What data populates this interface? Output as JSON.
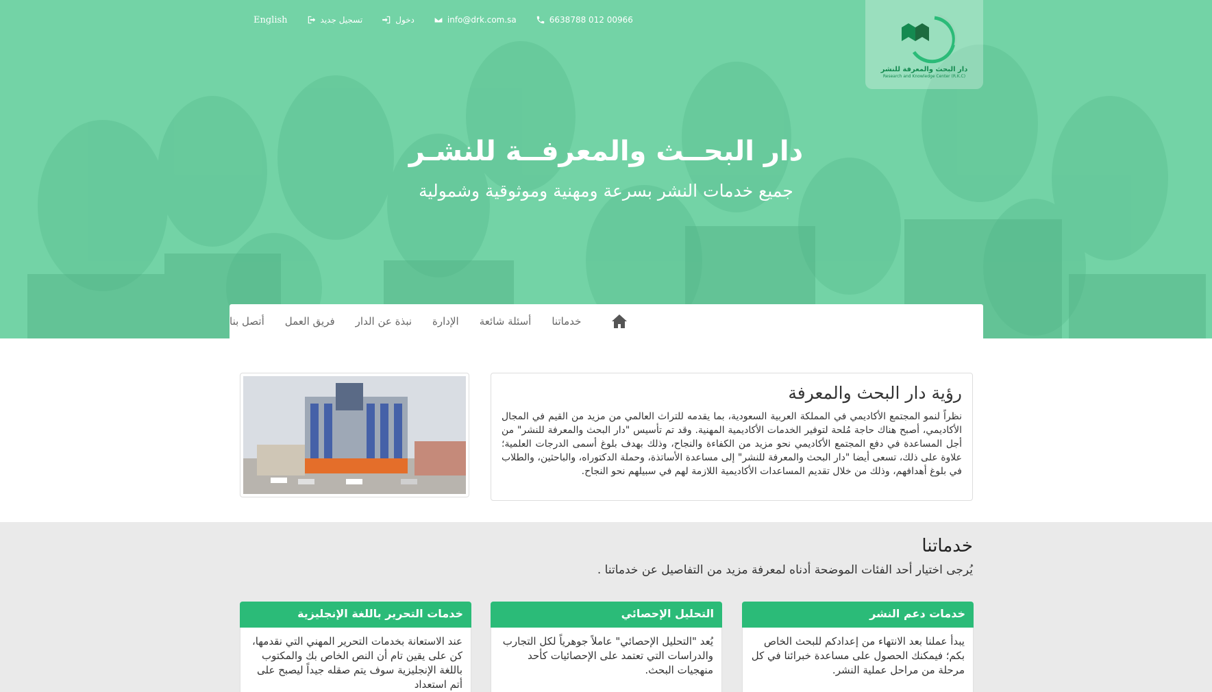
{
  "topbar": {
    "phone": "6638788 012 00966",
    "email": "info@drk.com.sa",
    "login": "دخول",
    "register": "تسجيل جديد",
    "language": "English"
  },
  "logo": {
    "name": "دار البحث والمعرفة للنشر",
    "subtitle": "Research and Knowledge Center (R.K.C)"
  },
  "hero": {
    "title": "دار البحــث والمعرفــة للنشـر",
    "subtitle": "جميع خدمات النشر بسرعة ومهنية وموثوقية وشمولية"
  },
  "nav": {
    "items": [
      "خدماتنا",
      "أسئلة شائعة",
      "الإدارة",
      "نبذة عن الدار",
      "فريق العمل",
      "أتصل بنا"
    ]
  },
  "about": {
    "title": "رؤية دار البحث والمعرفة",
    "text": "نظراً لنمو المجتمع الأكاديمي في المملكة العربية السعودية، بما يقدمه للتراث العالمي من مزيد من القيم في المجال الأكاديمي، أصبح هناك حاجة مُلحة لتوفير الخدمات الأكاديمية المهنية. وقد تم تأسيس \"دار البحث والمعرفة للنشر\" من أجل المساعدة في دفع المجتمع الأكاديمي نحو مزيد من الكفاءة والنجاح، وذلك بهدف بلوغ أسمى الدرجات العلمية؛ علاوة على ذلك، تسعى أيضا \"دار البحث والمعرفة للنشر\" إلى مساعدة الأساتذة، وحملة الدكتوراه، والباحثين، والطلاب في بلوغ أهدافهم، وذلك من خلال تقديم المساعدات الأكاديمية اللازمة لهم في سبيلهم نحو النجاح."
  },
  "services": {
    "title": "خدماتنا",
    "description": "يُرجى اختيار أحد الفئات الموضحة أدناه لمعرفة مزيد من التفاصيل عن خدماتنا .",
    "cards": [
      {
        "title": "خدمات دعم النشر",
        "text": "يبدأ عملنا بعد الانتهاء من إعدادكم للبحث الخاص بكم؛ فيمكنك الحصول على مساعدة خبرائنا في كل مرحلة من مراحل عملية النشر."
      },
      {
        "title": "التحليل الإحصائي",
        "text": "يُعد \"التحليل الإحصائي\" عاملاً جوهرياً لكل التجارب والدراسات التي تعتمد على الإحصائيات كأحد منهجيات البحث."
      },
      {
        "title": "خدمات التحرير باللغة الإنجليزية",
        "text": "عند الاستعانة بخدمات التحرير المهني التي نقدمها، كن على يقين تام أن النص الخاص بك والمكتوب باللغة الإنجليزية سوف يتم صقله جيداً ليصبح على أتم استعداد"
      }
    ]
  },
  "colors": {
    "brand_green": "#2bbb78",
    "hero_green": "#74d3a7"
  }
}
